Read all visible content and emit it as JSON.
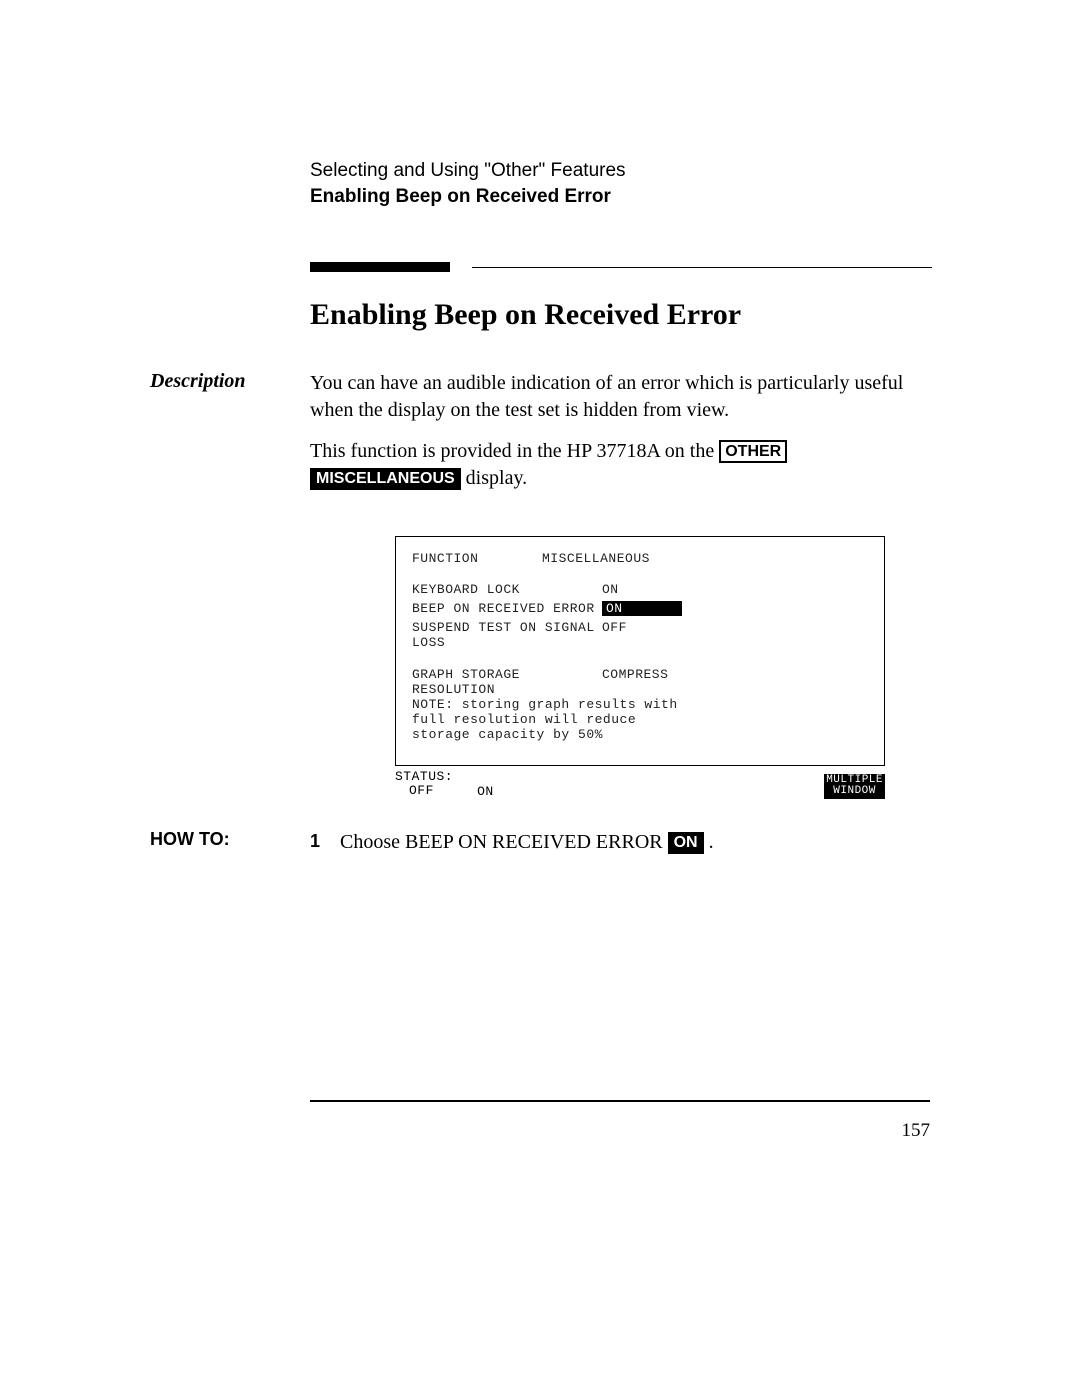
{
  "header": {
    "chapter": "Selecting and Using \"Other\" Features",
    "section": "Enabling Beep on Received Error"
  },
  "title": "Enabling Beep on Received Error",
  "description": {
    "label": "Description",
    "para1": "You can have an audible indication of an error which is particularly useful when the display on the test set is hidden from view.",
    "para2_a": "This function is provided in the HP 37718A on the ",
    "btn_other": "OTHER",
    "btn_misc": "MISCELLANEOUS",
    "para2_b": " display."
  },
  "lcd": {
    "function_label": "FUNCTION",
    "function_value": "MISCELLANEOUS",
    "rows": [
      {
        "label": "KEYBOARD LOCK",
        "value": "ON",
        "highlighted": false
      },
      {
        "label": "BEEP ON RECEIVED ERROR",
        "value": "ON",
        "highlighted": true
      },
      {
        "label": "SUSPEND TEST ON SIGNAL LOSS",
        "value": "OFF",
        "highlighted": false
      }
    ],
    "graph_label": "GRAPH STORAGE RESOLUTION",
    "graph_value": "COMPRESS",
    "note": "NOTE: storing graph results with full resolution will reduce storage capacity by 50%",
    "status_label": "STATUS:",
    "softkeys": {
      "off": "OFF",
      "on": "ON",
      "multiple": "MULTIPLE",
      "window": "WINDOW"
    }
  },
  "howto": {
    "label": "HOW TO:",
    "step_num": "1",
    "step_a": "Choose BEEP ON RECEIVED ERROR ",
    "btn_on": "ON",
    "step_b": " ."
  },
  "page_number": "157"
}
